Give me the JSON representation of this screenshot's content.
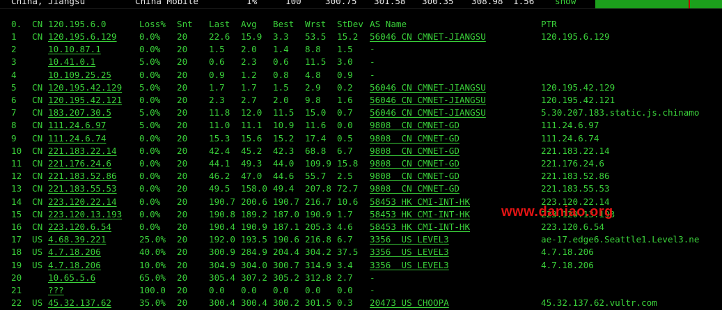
{
  "top_row": {
    "location": "China, Jiangsu",
    "isp": "China Mobile",
    "loss": "1%",
    "snt": "100",
    "avg": "300.75",
    "best": "301.58",
    "wrst": "300.35",
    "last": "308.98",
    "stdev": "1.56",
    "action": "show"
  },
  "colors": {
    "text_green": "#3ad13a",
    "background": "#000000",
    "progress_green": "#1ca01c",
    "marker_red": "#c00000",
    "watermark_red": "#e31414"
  },
  "headers": {
    "hop": "0.",
    "cc": "CN",
    "host": "120.195.6.0",
    "loss": "Loss%",
    "snt": "Snt",
    "last": "Last",
    "avg": "Avg",
    "best": "Best",
    "wrst": "Wrst",
    "stdev": "StDev",
    "as": "AS Name",
    "ptr": "PTR"
  },
  "rows": [
    {
      "hop": "1",
      "cc": "CN",
      "host": "120.195.6.129",
      "loss": "0.0%",
      "snt": "20",
      "last": "22.6",
      "avg": "15.9",
      "best": "3.3",
      "wrst": "53.5",
      "stdev": "15.2",
      "as": "56046 CN CMNET-JIANGSU",
      "ptr": "120.195.6.129"
    },
    {
      "hop": "2",
      "cc": "",
      "host": "10.10.87.1",
      "loss": "0.0%",
      "snt": "20",
      "last": "1.5",
      "avg": "2.0",
      "best": "1.4",
      "wrst": "8.8",
      "stdev": "1.5",
      "as": "-",
      "ptr": ""
    },
    {
      "hop": "3",
      "cc": "",
      "host": "10.41.0.1",
      "loss": "5.0%",
      "snt": "20",
      "last": "0.6",
      "avg": "2.3",
      "best": "0.6",
      "wrst": "11.5",
      "stdev": "3.0",
      "as": "-",
      "ptr": ""
    },
    {
      "hop": "4",
      "cc": "",
      "host": "10.109.25.25",
      "loss": "0.0%",
      "snt": "20",
      "last": "0.9",
      "avg": "1.2",
      "best": "0.8",
      "wrst": "4.8",
      "stdev": "0.9",
      "as": "-",
      "ptr": ""
    },
    {
      "hop": "5",
      "cc": "CN",
      "host": "120.195.42.129",
      "loss": "5.0%",
      "snt": "20",
      "last": "1.7",
      "avg": "1.7",
      "best": "1.5",
      "wrst": "2.9",
      "stdev": "0.2",
      "as": "56046 CN CMNET-JIANGSU",
      "ptr": "120.195.42.129"
    },
    {
      "hop": "6",
      "cc": "CN",
      "host": "120.195.42.121",
      "loss": "0.0%",
      "snt": "20",
      "last": "2.3",
      "avg": "2.7",
      "best": "2.0",
      "wrst": "9.8",
      "stdev": "1.6",
      "as": "56046 CN CMNET-JIANGSU",
      "ptr": "120.195.42.121"
    },
    {
      "hop": "7",
      "cc": "CN",
      "host": "183.207.30.5",
      "loss": "5.0%",
      "snt": "20",
      "last": "11.8",
      "avg": "12.0",
      "best": "11.5",
      "wrst": "15.0",
      "stdev": "0.7",
      "as": "56046 CN CMNET-JIANGSU",
      "ptr": "5.30.207.183.static.js.chinamo"
    },
    {
      "hop": "8",
      "cc": "CN",
      "host": "111.24.6.97",
      "loss": "5.0%",
      "snt": "20",
      "last": "11.0",
      "avg": "11.1",
      "best": "10.9",
      "wrst": "11.6",
      "stdev": "0.0",
      "as": "9808  CN CMNET-GD",
      "ptr": "111.24.6.97"
    },
    {
      "hop": "9",
      "cc": "CN",
      "host": "111.24.6.74",
      "loss": "0.0%",
      "snt": "20",
      "last": "15.3",
      "avg": "15.6",
      "best": "15.2",
      "wrst": "17.4",
      "stdev": "0.5",
      "as": "9808  CN CMNET-GD",
      "ptr": "111.24.6.74"
    },
    {
      "hop": "10",
      "cc": "CN",
      "host": "221.183.22.14",
      "loss": "0.0%",
      "snt": "20",
      "last": "42.4",
      "avg": "45.2",
      "best": "42.3",
      "wrst": "68.8",
      "stdev": "6.7",
      "as": "9808  CN CMNET-GD",
      "ptr": "221.183.22.14"
    },
    {
      "hop": "11",
      "cc": "CN",
      "host": "221.176.24.6",
      "loss": "0.0%",
      "snt": "20",
      "last": "44.1",
      "avg": "49.3",
      "best": "44.0",
      "wrst": "109.9",
      "stdev": "15.8",
      "as": "9808  CN CMNET-GD",
      "ptr": "221.176.24.6"
    },
    {
      "hop": "12",
      "cc": "CN",
      "host": "221.183.52.86",
      "loss": "0.0%",
      "snt": "20",
      "last": "46.2",
      "avg": "47.0",
      "best": "44.6",
      "wrst": "55.7",
      "stdev": "2.5",
      "as": "9808  CN CMNET-GD",
      "ptr": "221.183.52.86"
    },
    {
      "hop": "13",
      "cc": "CN",
      "host": "221.183.55.53",
      "loss": "0.0%",
      "snt": "20",
      "last": "49.5",
      "avg": "158.0",
      "best": "49.4",
      "wrst": "207.8",
      "stdev": "72.7",
      "as": "9808  CN CMNET-GD",
      "ptr": "221.183.55.53"
    },
    {
      "hop": "14",
      "cc": "CN",
      "host": "223.120.22.14",
      "loss": "0.0%",
      "snt": "20",
      "last": "190.7",
      "avg": "200.6",
      "best": "190.7",
      "wrst": "216.7",
      "stdev": "10.6",
      "as": "58453 HK CMI-INT-HK",
      "ptr": "223.120.22.14"
    },
    {
      "hop": "15",
      "cc": "CN",
      "host": "223.120.13.193",
      "loss": "0.0%",
      "snt": "20",
      "last": "190.8",
      "avg": "189.2",
      "best": "187.0",
      "wrst": "190.9",
      "stdev": "1.7",
      "as": "58453 HK CMI-INT-HK",
      "ptr": "223.120.13.193"
    },
    {
      "hop": "16",
      "cc": "CN",
      "host": "223.120.6.54",
      "loss": "0.0%",
      "snt": "20",
      "last": "190.4",
      "avg": "190.9",
      "best": "187.1",
      "wrst": "205.3",
      "stdev": "4.6",
      "as": "58453 HK CMI-INT-HK",
      "ptr": "223.120.6.54"
    },
    {
      "hop": "17",
      "cc": "US",
      "host": "4.68.39.221",
      "loss": "25.0%",
      "snt": "20",
      "last": "192.0",
      "avg": "193.5",
      "best": "190.6",
      "wrst": "216.8",
      "stdev": "6.7",
      "as": "3356  US LEVEL3",
      "ptr": "ae-17.edge6.Seattle1.Level3.ne"
    },
    {
      "hop": "18",
      "cc": "US",
      "host": "4.7.18.206",
      "loss": "40.0%",
      "snt": "20",
      "last": "300.9",
      "avg": "284.9",
      "best": "204.4",
      "wrst": "304.2",
      "stdev": "37.5",
      "as": "3356  US LEVEL3",
      "ptr": "4.7.18.206"
    },
    {
      "hop": "19",
      "cc": "US",
      "host": "4.7.18.206",
      "loss": "10.0%",
      "snt": "20",
      "last": "304.9",
      "avg": "304.0",
      "best": "300.7",
      "wrst": "314.9",
      "stdev": "3.4",
      "as": "3356  US LEVEL3",
      "ptr": "4.7.18.206"
    },
    {
      "hop": "20",
      "cc": "",
      "host": "10.65.5.6",
      "loss": "65.0%",
      "snt": "20",
      "last": "305.4",
      "avg": "307.2",
      "best": "305.2",
      "wrst": "312.8",
      "stdev": "2.7",
      "as": "-",
      "ptr": ""
    },
    {
      "hop": "21",
      "cc": "",
      "host": "???",
      "loss": "100.0",
      "snt": "20",
      "last": "0.0",
      "avg": "0.0",
      "best": "0.0",
      "wrst": "0.0",
      "stdev": "0.0",
      "as": "-",
      "ptr": ""
    },
    {
      "hop": "22",
      "cc": "US",
      "host": "45.32.137.62",
      "loss": "35.0%",
      "snt": "20",
      "last": "300.4",
      "avg": "300.4",
      "best": "300.2",
      "wrst": "301.5",
      "stdev": "0.3",
      "as": "20473 US CHOOPA",
      "ptr": "45.32.137.62.vultr.com"
    }
  ],
  "watermark": "www.daniao.org"
}
